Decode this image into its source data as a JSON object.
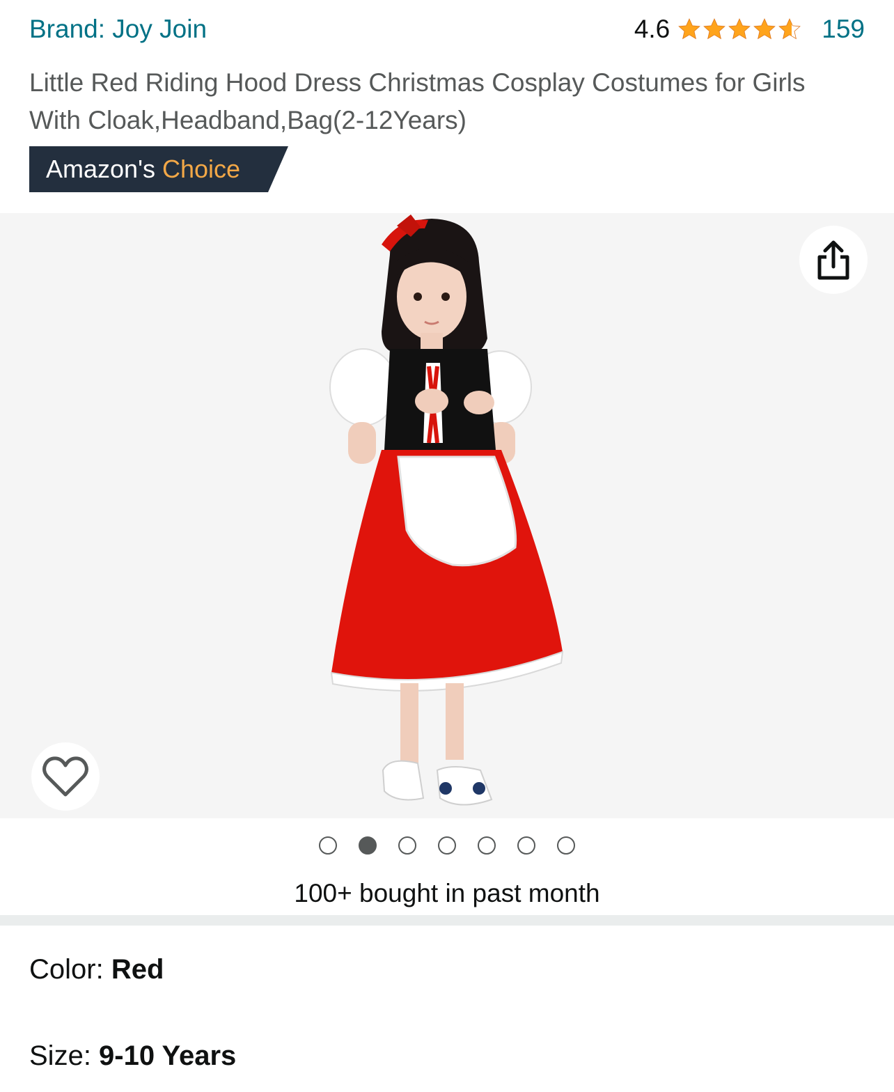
{
  "header": {
    "brand_link": "Brand: Joy Join",
    "rating_value": "4.6",
    "rating_stars": 4.6,
    "review_count": "159"
  },
  "product": {
    "title": "Little Red Riding Hood Dress Christmas Cosplay Costumes for Girls With Cloak,Headband,Bag(2-12Years)",
    "badge_prefix": "Amazon's ",
    "badge_accent": "Choice"
  },
  "gallery": {
    "image_count": 7,
    "active_index": 1,
    "share_icon": "share-icon",
    "wishlist_icon": "heart-icon"
  },
  "social_proof": {
    "bought_text": "100+ bought in past month"
  },
  "variations": {
    "color_label": "Color: ",
    "color_value": "Red",
    "size_label": "Size: ",
    "size_value": "9-10 Years"
  },
  "colors": {
    "link": "#007185",
    "badge_bg": "#232f3e",
    "badge_accent": "#f3a847",
    "star": "#ffa41c",
    "gallery_bg": "#f5f5f5"
  }
}
